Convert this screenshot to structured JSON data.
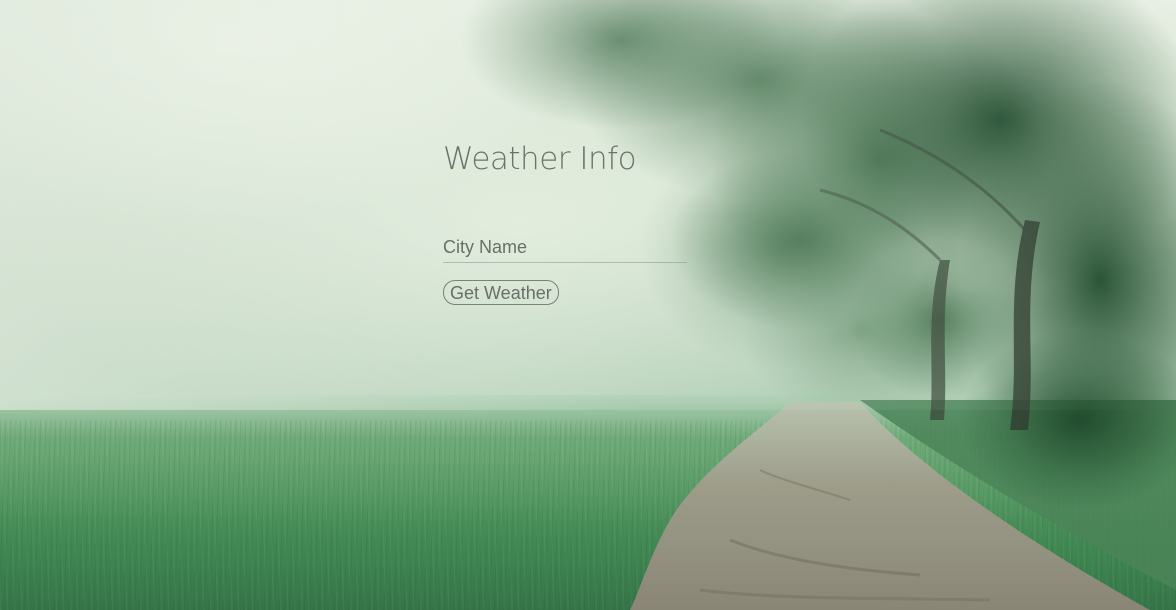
{
  "app": {
    "title": "Weather Info"
  },
  "search": {
    "placeholder": "City Name",
    "value": ""
  },
  "actions": {
    "get_weather_label": "Get Weather"
  },
  "colors": {
    "text": "#6c716b",
    "button_border": "#7b807a",
    "fog": "#dbe6d7",
    "grass": "#3f8753",
    "foliage": "#2f5b3a"
  }
}
